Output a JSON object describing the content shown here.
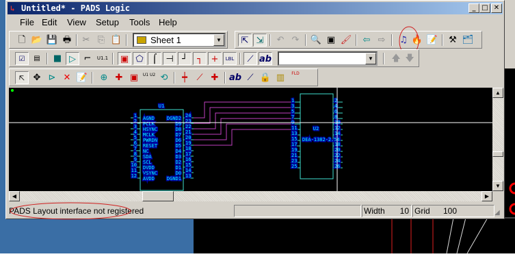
{
  "window": {
    "title": "Untitled* - PADS Logic",
    "minimize": "_",
    "maximize": "□",
    "close": "✕"
  },
  "menu": [
    {
      "label": "File"
    },
    {
      "label": "Edit"
    },
    {
      "label": "View"
    },
    {
      "label": "Setup"
    },
    {
      "label": "Tools"
    },
    {
      "label": "Help"
    }
  ],
  "toolbar1": {
    "sheet_select": "Sheet 1",
    "icons": [
      "new-icon",
      "open-icon",
      "save-icon",
      "print-icon",
      "cut-icon",
      "copy-icon",
      "paste-icon",
      "select-filter-icon",
      "select-mode-icon",
      "undo-icon",
      "redo-icon",
      "zoom-icon",
      "view-icon",
      "redraw-icon",
      "back-annotate-icon",
      "forward-annotate-icon",
      "route-interface-icon",
      "hot-icon",
      "properties-icon",
      "hyperlynx-icon",
      "library-icon"
    ]
  },
  "toolbar2": {
    "text_combo": "",
    "icons": [
      "select-schematic-icon",
      "select-part-icon",
      "add-part-icon",
      "add-gate-icon",
      "add-connection-icon",
      "add-ref-icon",
      "hierarchical-icon",
      "off-page-icon",
      "power-icon",
      "ground-icon",
      "net-label-icon",
      "bus-icon",
      "junction-icon",
      "label-icon",
      "2d-line-icon",
      "text-icon",
      "up-arrow-icon",
      "down-arrow-icon"
    ],
    "labels": {
      "u11": "U1.1",
      "lbl": "LBL",
      "ab": "ab"
    }
  },
  "toolbar3": {
    "labels": {
      "u1u2": "U1 U2",
      "fld": "FLD",
      "ab": "ab"
    }
  },
  "schematic": {
    "u1": {
      "ref": "U1",
      "left_pins": [
        {
          "num": "1",
          "name": "AGND"
        },
        {
          "num": "2",
          "name": "PCLK"
        },
        {
          "num": "3",
          "name": "HSYNC"
        },
        {
          "num": "4",
          "name": "MCLK"
        },
        {
          "num": "5",
          "name": "PWRDN"
        },
        {
          "num": "6",
          "name": "RESET"
        },
        {
          "num": "7",
          "name": "NC"
        },
        {
          "num": "8",
          "name": "SDA"
        },
        {
          "num": "9",
          "name": "SCL"
        },
        {
          "num": "10",
          "name": "DVDD"
        },
        {
          "num": "11",
          "name": "VSYNC"
        },
        {
          "num": "12",
          "name": "AVDD"
        }
      ],
      "right_pins": [
        {
          "num": "24",
          "name": "DGND2"
        },
        {
          "num": "23",
          "name": "D9"
        },
        {
          "num": "22",
          "name": "D8"
        },
        {
          "num": "21",
          "name": "D7"
        },
        {
          "num": "20",
          "name": "D6"
        },
        {
          "num": "19",
          "name": "D5"
        },
        {
          "num": "18",
          "name": "D4"
        },
        {
          "num": "17",
          "name": "D3"
        },
        {
          "num": "16",
          "name": "D2"
        },
        {
          "num": "15",
          "name": "D1"
        },
        {
          "num": "14",
          "name": "D0"
        },
        {
          "num": "13",
          "name": "DGND1"
        }
      ]
    },
    "u2": {
      "ref": "U2",
      "value": "DEA-1382-2.54",
      "left_pins": [
        "1",
        "3",
        "5",
        "7",
        "9",
        "11",
        "13",
        "15",
        "17",
        "19",
        "21",
        "23",
        "25"
      ],
      "right_pins": [
        "2",
        "4",
        "6",
        "8",
        "10",
        "12",
        "14",
        "16",
        "18",
        "20",
        "22",
        "24",
        "26"
      ]
    },
    "colors": {
      "part": "#40e0d0",
      "pin_label": "#00ffff",
      "label_bg": "#0000a0",
      "wire": "#c040c0",
      "cursor": "#ffffff"
    }
  },
  "status": {
    "message": "PADS Layout interface not registered",
    "width_label": "Width",
    "width_value": "10",
    "grid_label": "Grid",
    "grid_value": "100"
  }
}
